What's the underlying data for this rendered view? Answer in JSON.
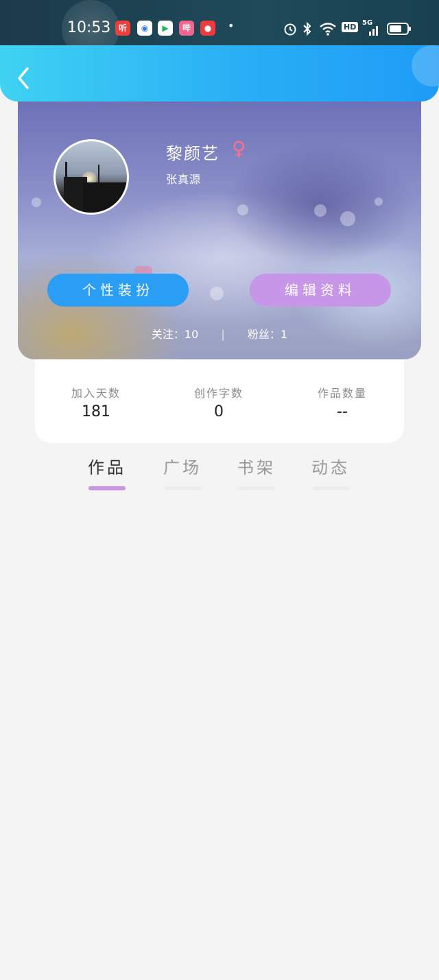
{
  "status_bar": {
    "time": "10:53",
    "apps": [
      {
        "name": "ting-app-icon",
        "text": "听",
        "color": "#e8403a"
      },
      {
        "name": "browser-app-icon",
        "text": "◉",
        "color": "#2f7be6"
      },
      {
        "name": "play-app-icon",
        "text": "▶",
        "color": "#21b65a"
      },
      {
        "name": "bilibili-app-icon",
        "text": "哔",
        "color": "#f2668e"
      },
      {
        "name": "video-app-icon",
        "text": "●",
        "color": "#ea3c3c"
      }
    ],
    "network": "5G",
    "hd": "HD"
  },
  "profile": {
    "username": "黎颜艺",
    "gender_symbol": "♀",
    "signature": "张真源",
    "buttons": {
      "dress_label": "个性装扮",
      "edit_label": "编辑资料"
    },
    "following_label": "关注：10",
    "fans_label": "粉丝：1",
    "separator": "|"
  },
  "stats": [
    {
      "label": "加入天数",
      "value": "181"
    },
    {
      "label": "创作字数",
      "value": "0"
    },
    {
      "label": "作品数量",
      "value": "--"
    }
  ],
  "tabs": [
    {
      "label": "作品",
      "active": true
    },
    {
      "label": "广场",
      "active": false
    },
    {
      "label": "书架",
      "active": false
    },
    {
      "label": "动态",
      "active": false
    }
  ],
  "colors": {
    "header_start": "#3fd2f2",
    "header_end": "#1e9cf6",
    "dress_button": "#2a9df4",
    "edit_button": "#c796e8",
    "active_tab_underline": "#c796e8",
    "gender": "#ff6f86"
  }
}
